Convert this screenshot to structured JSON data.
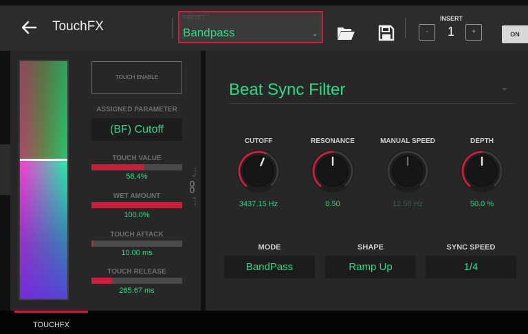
{
  "header": {
    "title": "TouchFX",
    "preset_caption": "PRESET",
    "preset_value": "Bandpass",
    "insert_label": "INSERT",
    "insert_number": "1",
    "decrement_label": "-",
    "increment_label": "+",
    "power_label": "ON"
  },
  "touch": {
    "enable_label": "TOUCH ENABLE",
    "assigned_parameter_label": "ASSIGNED PARAMETER",
    "assigned_parameter_value": "(BF) Cutoff",
    "params": [
      {
        "label": "TOUCH VALUE",
        "value": "58.4%",
        "fraction": 0.584
      },
      {
        "label": "WET AMOUNT",
        "value": "100.0%",
        "fraction": 1.0
      },
      {
        "label": "TOUCH ATTACK",
        "value": "10.00 ms",
        "fraction": 0.02
      },
      {
        "label": "TOUCH RELEASE",
        "value": "265.67 ms",
        "fraction": 0.23
      }
    ]
  },
  "effect": {
    "name": "Beat Sync Filter",
    "knobs": [
      {
        "label": "CUTOFF",
        "value": "3437.15 Hz",
        "fraction": 0.58,
        "active": true
      },
      {
        "label": "RESONANCE",
        "value": "0.50",
        "fraction": 0.5,
        "active": true
      },
      {
        "label": "MANUAL SPEED",
        "value": "12.58 Hz",
        "fraction": 0.5,
        "active": false
      },
      {
        "label": "DEPTH",
        "value": "50.0 %",
        "fraction": 0.5,
        "active": true
      }
    ],
    "selectors": [
      {
        "label": "MODE",
        "value": "BandPass"
      },
      {
        "label": "SHAPE",
        "value": "Ramp Up"
      },
      {
        "label": "SYNC SPEED",
        "value": "1/4"
      }
    ]
  },
  "tabs": [
    {
      "label": "TOUCHFX",
      "active": true
    }
  ],
  "colors": {
    "accent_green": "#31d986",
    "accent_red": "#c51f3b",
    "panel": "#272727",
    "background": "#111111"
  }
}
